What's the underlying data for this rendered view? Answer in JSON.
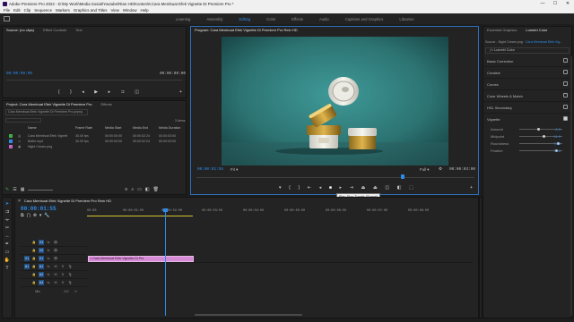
{
  "titlebar": {
    "title": "Adobe Premiere Pro 2022 - D:\\My Work\\Media Sosial\\Youtube\\Rian HD\\Konten\\8.Cara Membuat Efek Vignette Di Premiere Pro *",
    "min": "—",
    "max": "☐",
    "close": "✕"
  },
  "menu": [
    "File",
    "Edit",
    "Clip",
    "Sequence",
    "Markers",
    "Graphics and Titles",
    "View",
    "Window",
    "Help"
  ],
  "workspaces": [
    "Learning",
    "Assembly",
    "Editing",
    "Color",
    "Effects",
    "Audio",
    "Captions and Graphics",
    "Libraries"
  ],
  "source": {
    "tabs": [
      "Source: (no clips)",
      "Effect Controls",
      "Text"
    ],
    "timecode_left": "00:00:00:00",
    "timecode_right": "00:00:00:00"
  },
  "project": {
    "tabs": [
      "Project: Cara Membuat Efek Vignette Di Premiere Pro",
      "Effects"
    ],
    "path": "Cara Membuat Efek Vignette Di Premiere Pro.prproj",
    "item_count": "3 items",
    "columns": [
      "Name",
      "Frame Rate",
      "Media Start",
      "Media End",
      "Media Duration"
    ],
    "rows": [
      {
        "color": "#3fae49",
        "name": "Cara Membuat Efek Vignett",
        "fps": "30.00 fps",
        "start": "00:00:00:00",
        "end": "00:00:02:24",
        "dur": "00:00:03:00"
      },
      {
        "color": "#2d8ceb",
        "name": "Bottle.mp4",
        "fps": "30.00 fps",
        "start": "00:00:00:00",
        "end": "00:00:02:24",
        "dur": "00:00:03:00"
      },
      {
        "color": "#c462c4",
        "name": "Night Cream.png",
        "fps": "",
        "start": "",
        "end": "",
        "dur": ""
      }
    ]
  },
  "program": {
    "title": "Program: Cara Membuat Efek Vignette Di Premiere Pro Rein HD",
    "timecode_left": "00:00:01:55",
    "fit": "Fit",
    "full": "Full",
    "timecode_right": "00:00:03:00",
    "tooltip": "Play-Stop Toggle (Space)"
  },
  "timeline": {
    "tab": "Cara Membuat Efek Vignette Di Premiere Pro Rein HD",
    "timecode": "00:00:01:55",
    "ruler": [
      "00:00",
      "00:00:01:00",
      "00:00:02:00",
      "00:00:03:00",
      "00:00:04:00",
      "00:00:05:00",
      "00:00:06:00",
      "00:00:07:00",
      "00:00:08:00"
    ],
    "tracks": [
      "V3",
      "V2",
      "V1",
      "A1",
      "A2",
      "A3",
      "Mix"
    ],
    "clip_label": "Cara Membuat Efek Vignette Di Pre",
    "mix_value": "0.0"
  },
  "lumetri": {
    "tabs": [
      "Essential Graphics",
      "Lumetri Color"
    ],
    "source_label": "Source - Night Cream.png",
    "source_target": "Cara Membuat Efek Vig...",
    "effect": "Lumetri Color",
    "sections": [
      "Basic Correction",
      "Creative",
      "Curves",
      "Color Wheels & Match",
      "HSL Secondary",
      "Vignette"
    ],
    "vignette": [
      {
        "label": "Amount",
        "value": "-3.3",
        "pos": 0.42
      },
      {
        "label": "Midpoint",
        "value": "11.9",
        "pos": 0.55
      },
      {
        "label": "Roundness",
        "value": "76.8",
        "pos": 0.88
      },
      {
        "label": "Feather",
        "value": "70.6",
        "pos": 0.85
      }
    ]
  }
}
